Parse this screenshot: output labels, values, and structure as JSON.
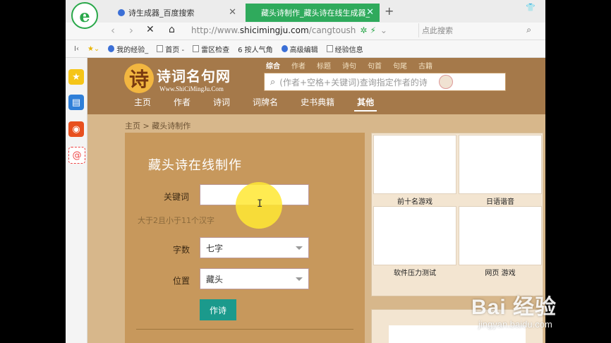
{
  "browser": {
    "tabs": [
      {
        "label": "诗生成器_百度搜索"
      },
      {
        "label": "藏头诗制作_藏头诗在线生成器_"
      }
    ],
    "url_prefix": "http://www.",
    "url_host": "shicimingju.com",
    "url_path": "/cangtoush",
    "search_placeholder": "点此搜索",
    "bookmarks": [
      "我的经验_",
      "首页 -",
      "雷区检查",
      "6 按人气角",
      "高级编辑",
      "经验信息"
    ]
  },
  "site": {
    "logo_glyph": "诗",
    "title": "诗词名句网",
    "subtitle": "Www.ShiCiMingJu.Com",
    "categories": [
      "综合",
      "作者",
      "标题",
      "诗句",
      "句首",
      "句尾",
      "古籍"
    ],
    "search_placeholder": "(作者+空格+关键词)查询指定作者的诗",
    "nav": [
      "主页",
      "作者",
      "诗词",
      "词牌名",
      "史书典籍",
      "其他"
    ],
    "breadcrumb": "主页 > 藏头诗制作"
  },
  "form": {
    "title": "藏头诗在线制作",
    "keyword_label": "关键词",
    "keyword_value": "",
    "hint": "大于2且小于11个汉字",
    "length_label": "字数",
    "length_value": "七字",
    "position_label": "位置",
    "position_value": "藏头",
    "submit_label": "作诗"
  },
  "ads": [
    "前十名游戏",
    "日语谐音",
    "软件压力测试",
    "网页 游戏"
  ],
  "watermark": {
    "brand": "Bai 经验",
    "url": "jingyan.baidu.com"
  }
}
